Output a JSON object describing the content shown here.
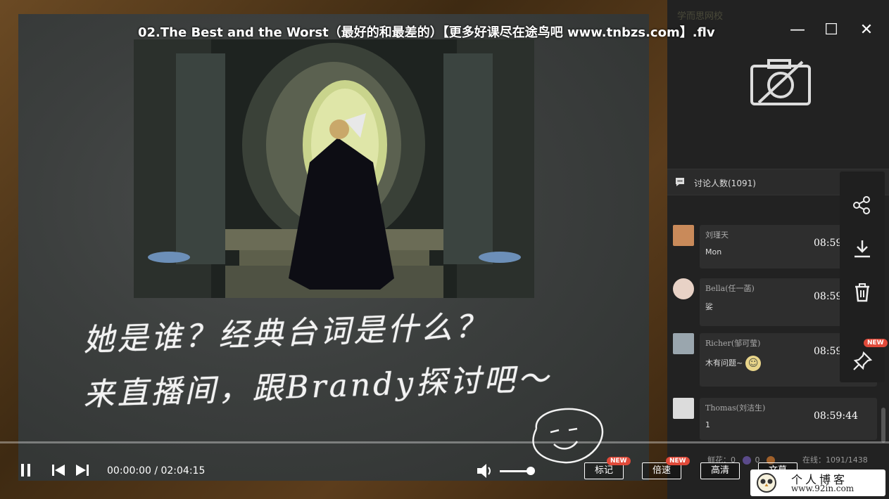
{
  "window": {
    "title": "02.The Best and the Worst（最好的和最差的）【更多好课尽在途鸟吧 www.tnbzs.com】.flv",
    "minimize_glyph": "—",
    "maximize_glyph": "☐",
    "close_glyph": "✕"
  },
  "board": {
    "chalk_line1": "她是谁？经典台词是什么？",
    "chalk_line2": "来直播间，跟Brandy探讨吧～"
  },
  "side": {
    "brand": "学而思网校",
    "discussion_label": "讨论人数(1091)",
    "messages": [
      {
        "name": "刘瑾天",
        "time": "08:59:42",
        "body": "Mon",
        "avatar_color": "#c98a5a"
      },
      {
        "name": "Bella(任一菡)",
        "time": "08:59:42",
        "body": "娑",
        "avatar_color": "#e8d2c6"
      },
      {
        "name": "Richer(邹可莹)",
        "time": "08:59:42",
        "body": "木有问题~",
        "avatar_color": "#9aa6ae",
        "emoji": "☺"
      },
      {
        "name": "Thomas(刘洁生)",
        "time": "08:59:44",
        "body": "1",
        "avatar_color": "#dcdcdc"
      }
    ],
    "stats_flower": "鲜花：",
    "stats_v1": "0",
    "stats_v2": "0",
    "stats_online": "在线：1091/1438",
    "tools": {
      "share": "share-icon",
      "download": "download-icon",
      "delete": "trash-icon",
      "pin": "pin-icon",
      "new_badge": "NEW"
    }
  },
  "player": {
    "time_display": "00:00:00 / 02:04:15",
    "buttons": {
      "mark": "标记",
      "speed": "倍速",
      "quality": "高清",
      "caption": "文幕"
    },
    "new_badge": "NEW",
    "volume_level": 0.85
  },
  "watermark": {
    "line1": "个人博客",
    "line2": "www.92in.com"
  }
}
